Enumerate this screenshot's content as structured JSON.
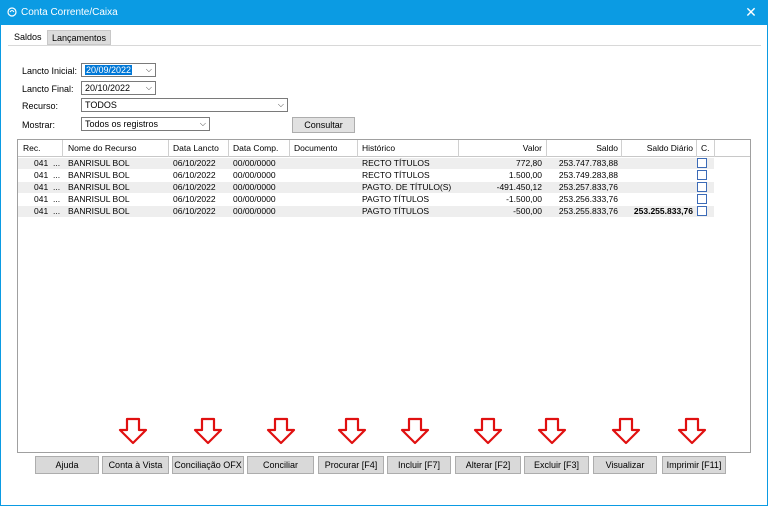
{
  "window": {
    "title": "Conta Corrente/Caixa",
    "close_symbol": "✕"
  },
  "tabs": [
    "Saldos",
    "Lançamentos"
  ],
  "filters": {
    "lancto_inicial_label": "Lancto Inicial:",
    "lancto_inicial_value": "20/09/2022",
    "lancto_final_label": "Lancto Final:",
    "lancto_final_value": "20/10/2022",
    "recurso_label": "Recurso:",
    "recurso_value": "TODOS",
    "mostrar_label": "Mostrar:",
    "mostrar_value": "Todos os registros",
    "consultar_label": "Consultar"
  },
  "table": {
    "columns": [
      "Rec.",
      "Nome do Recurso",
      "Data Lancto",
      "Data Comp.",
      "Documento",
      "Histórico",
      "Valor",
      "Saldo",
      "Saldo Diário",
      "C."
    ],
    "rows": [
      {
        "rec": "041",
        "ell": "...",
        "nome": "BANRISUL BOL",
        "data_lancto": "06/10/2022",
        "data_comp": "00/00/0000",
        "documento": "",
        "historico": "RECTO TÍTULOS",
        "valor": "772,80",
        "saldo": "253.747.783,88",
        "saldo_diario": "",
        "checked": false
      },
      {
        "rec": "041",
        "ell": "...",
        "nome": "BANRISUL BOL",
        "data_lancto": "06/10/2022",
        "data_comp": "00/00/0000",
        "documento": "",
        "historico": "RECTO TÍTULOS",
        "valor": "1.500,00",
        "saldo": "253.749.283,88",
        "saldo_diario": "",
        "checked": false
      },
      {
        "rec": "041",
        "ell": "...",
        "nome": "BANRISUL BOL",
        "data_lancto": "06/10/2022",
        "data_comp": "00/00/0000",
        "documento": "",
        "historico": "PAGTO. DE TÍTULO(S)",
        "valor": "-491.450,12",
        "saldo": "253.257.833,76",
        "saldo_diario": "",
        "checked": false
      },
      {
        "rec": "041",
        "ell": "...",
        "nome": "BANRISUL BOL",
        "data_lancto": "06/10/2022",
        "data_comp": "00/00/0000",
        "documento": "",
        "historico": "PAGTO TÍTULOS",
        "valor": "-1.500,00",
        "saldo": "253.256.333,76",
        "saldo_diario": "",
        "checked": false
      },
      {
        "rec": "041",
        "ell": "...",
        "nome": "BANRISUL BOL",
        "data_lancto": "06/10/2022",
        "data_comp": "00/00/0000",
        "documento": "",
        "historico": "PAGTO TÍTULOS",
        "valor": "-500,00",
        "saldo": "253.255.833,76",
        "saldo_diario": "253.255.833,76",
        "checked": false
      }
    ]
  },
  "actions": [
    "Ajuda",
    "Conta à Vista",
    "Conciliação OFX",
    "Conciliar",
    "Procurar [F4]",
    "Incluir [F7]",
    "Alterar [F2]",
    "Excluir [F3]",
    "Visualizar",
    "Imprimir [F11]"
  ],
  "colors": {
    "titlebar": "#0b9be3",
    "arrow": "#e01010",
    "selection": "#0078d7"
  },
  "icons": {
    "app": "app-logo-icon",
    "close": "close-icon",
    "dropdown": "chevron-down-icon",
    "arrow": "arrow-down-icon",
    "checkbox": "checkbox-icon"
  }
}
